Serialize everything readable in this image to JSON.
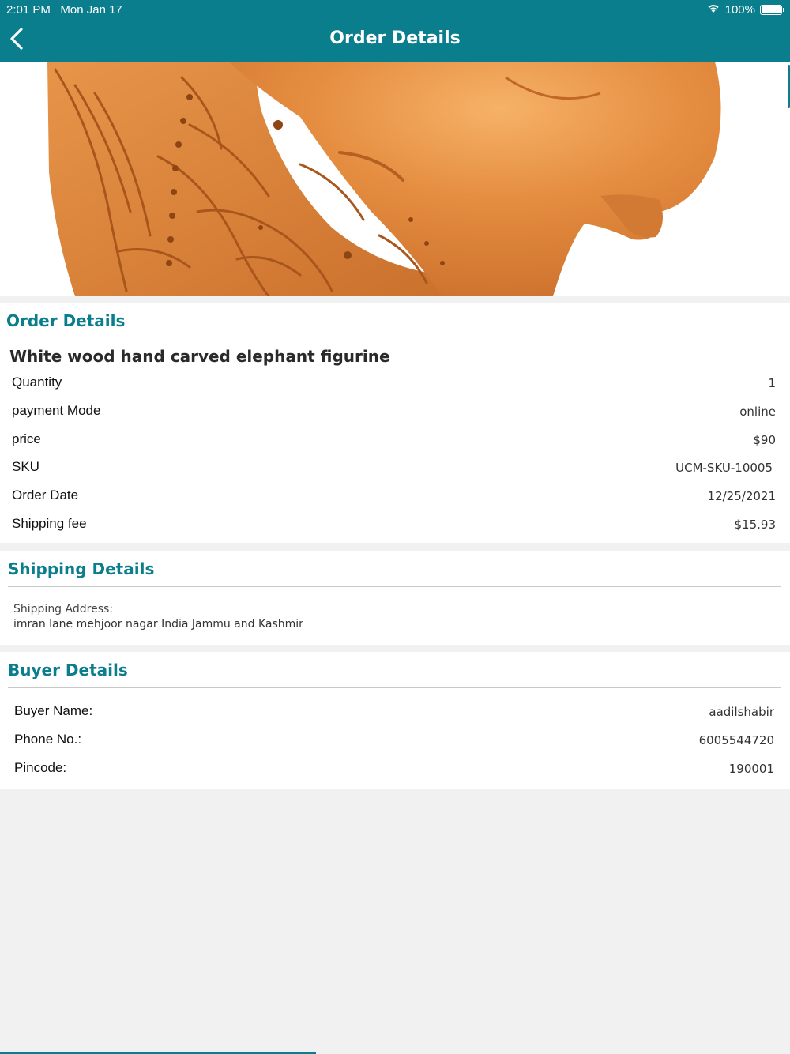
{
  "status_bar": {
    "time": "2:01 PM",
    "date": "Mon Jan 17",
    "battery": "100%"
  },
  "nav": {
    "title": "Order Details",
    "back_icon": "chevron-left-icon"
  },
  "hero_image": {
    "subject": "carved wood elephant"
  },
  "order": {
    "section_title": "Order Details",
    "product_name": "White wood hand carved elephant figurine",
    "rows": [
      {
        "label": "Quantity",
        "value": "1"
      },
      {
        "label": "payment Mode",
        "value": "online"
      },
      {
        "label": "price",
        "value": "$90"
      },
      {
        "label": "SKU",
        "value": "UCM-SKU-10005"
      },
      {
        "label": "Order Date",
        "value": "12/25/2021"
      },
      {
        "label": "Shipping fee",
        "value": "$15.93"
      }
    ]
  },
  "shipping": {
    "section_title": "Shipping Details",
    "address_label": "Shipping Address:",
    "address_value": "imran lane mehjoor nagar India  Jammu and Kashmir"
  },
  "buyer": {
    "section_title": "Buyer Details",
    "rows": [
      {
        "label": "Buyer Name:",
        "value": "aadilshabir"
      },
      {
        "label": "Phone No.:",
        "value": "6005544720"
      },
      {
        "label": "Pincode:",
        "value": "190001"
      }
    ]
  },
  "colors": {
    "accent": "#0a7e8c",
    "background": "#f1f1f1",
    "card": "#ffffff",
    "wood": "#d9823a"
  }
}
